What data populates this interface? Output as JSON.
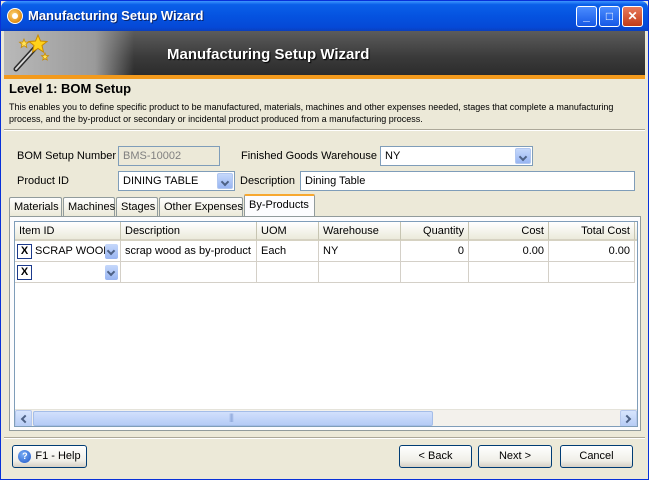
{
  "window": {
    "title": "Manufacturing Setup Wizard"
  },
  "banner": {
    "title": "Manufacturing Setup Wizard"
  },
  "header": {
    "level_title": "Level 1: BOM Setup",
    "description": "This enables you to define specific product to be manufactured, materials, machines and other expenses needed, stages that complete a manufacturing process, and the by-product or secondary or incidental product produced from a manufacturing process."
  },
  "form": {
    "bom_label": "BOM Setup Number",
    "bom_value": "BMS-10002",
    "warehouse_label": "Finished Goods Warehouse",
    "warehouse_value": "NY",
    "product_label": "Product ID",
    "product_value": "DINING TABLE",
    "description_label": "Description",
    "description_value": "Dining Table"
  },
  "tabs": [
    {
      "label": "Materials"
    },
    {
      "label": "Machines"
    },
    {
      "label": "Stages"
    },
    {
      "label": "Other Expenses"
    },
    {
      "label": "By-Products"
    }
  ],
  "grid": {
    "columns": [
      "Item ID",
      "Description",
      "UOM",
      "Warehouse",
      "Quantity",
      "Cost",
      "Total Cost"
    ],
    "rows": [
      {
        "item_id": "SCRAP WOOD",
        "description": "scrap wood as by-product",
        "uom": "Each",
        "warehouse": "NY",
        "quantity": "0",
        "cost": "0.00",
        "total_cost": "0.00"
      }
    ],
    "remove_glyph": "X"
  },
  "footer": {
    "help_label": "F1 - Help",
    "back_label": "< Back",
    "next_label": "Next >",
    "cancel_label": "Cancel"
  },
  "icons": {
    "title": "app-orb-icon",
    "banner": "magic-wand-stars-icon",
    "help": "help-question-icon"
  },
  "colors": {
    "titlebar": "#0553e0",
    "accent": "#f39a1c",
    "banner": "#3a3a3a"
  }
}
